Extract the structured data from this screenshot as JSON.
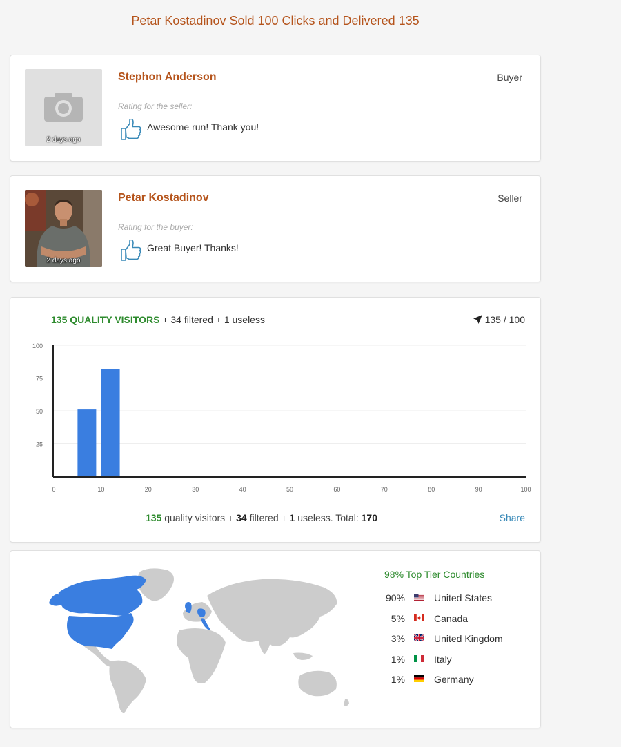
{
  "page_title": "Petar Kostadinov Sold 100 Clicks and Delivered 135",
  "reviews": [
    {
      "name": "Stephon Anderson",
      "role": "Buyer",
      "hint": "Rating for the seller:",
      "text": "Awesome run! Thank you!",
      "time": "2 days ago",
      "photo": "camera-placeholder"
    },
    {
      "name": "Petar Kostadinov",
      "role": "Seller",
      "hint": "Rating for the buyer:",
      "text": "Great Buyer! Thanks!",
      "time": "2 days ago",
      "photo": "user-photo"
    }
  ],
  "visitors": {
    "quality": "135",
    "quality_label": "QUALITY VISITORS",
    "filtered_text": "+ 34 filtered + 1 useless",
    "count": "135 / 100",
    "totals": {
      "quality": "135",
      "quality_label": "quality visitors +",
      "filtered": "34",
      "filtered_label": "filtered +",
      "useless": "1",
      "useless_label": "useless. Total:",
      "total": "170"
    },
    "share_label": "Share"
  },
  "chart_data": {
    "type": "bar",
    "x": [
      7,
      12
    ],
    "values": [
      51,
      82
    ],
    "xlim": [
      0,
      100
    ],
    "ylim": [
      0,
      100
    ],
    "xticks": [
      0,
      10,
      20,
      30,
      40,
      50,
      60,
      70,
      80,
      90,
      100
    ],
    "yticks": [
      25,
      50,
      75,
      100
    ],
    "color": "#3a7ee0"
  },
  "geo": {
    "tier_title": "98% Top Tier Countries",
    "countries": [
      {
        "pct": "90%",
        "name": "United States",
        "flag": "us-flag"
      },
      {
        "pct": "5%",
        "name": "Canada",
        "flag": "ca-flag"
      },
      {
        "pct": "3%",
        "name": "United Kingdom",
        "flag": "gb-flag"
      },
      {
        "pct": "1%",
        "name": "Italy",
        "flag": "it-flag"
      },
      {
        "pct": "1%",
        "name": "Germany",
        "flag": "de-flag"
      }
    ],
    "highlight_color": "#3a7ee0",
    "base_color": "#cccccc"
  }
}
